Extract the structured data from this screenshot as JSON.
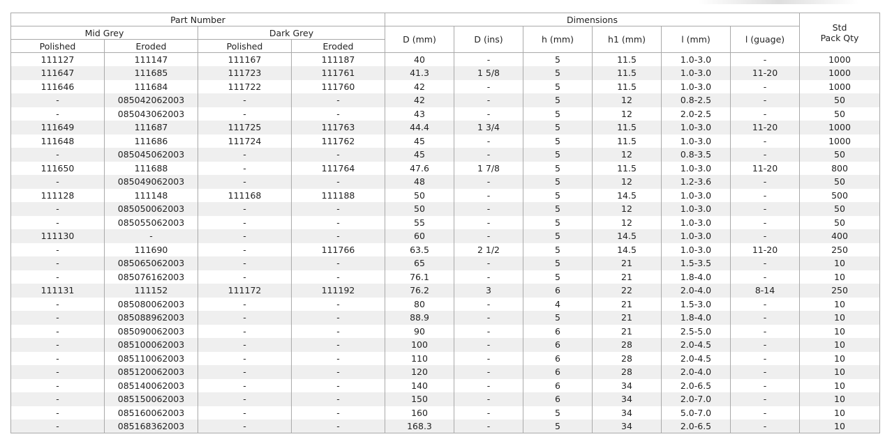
{
  "headers": {
    "part_number": "Part Number",
    "dimensions": "Dimensions",
    "std_line1": "Std",
    "std_line2": "Pack Qty",
    "mid_grey": "Mid Grey",
    "dark_grey": "Dark Grey",
    "polished": "Polished",
    "eroded": "Eroded",
    "d_mm": "D (mm)",
    "d_ins": "D (ins)",
    "h_mm": "h (mm)",
    "h1_mm": "h1 (mm)",
    "l_mm": "l (mm)",
    "l_guage": "l (guage)"
  },
  "rows": [
    [
      "111127",
      "111147",
      "111167",
      "111187",
      "40",
      "-",
      "5",
      "11.5",
      "1.0-3.0",
      "-",
      "1000"
    ],
    [
      "111647",
      "111685",
      "111723",
      "111761",
      "41.3",
      "1 5/8",
      "5",
      "11.5",
      "1.0-3.0",
      "11-20",
      "1000"
    ],
    [
      "111646",
      "111684",
      "111722",
      "111760",
      "42",
      "-",
      "5",
      "11.5",
      "1.0-3.0",
      "-",
      "1000"
    ],
    [
      "-",
      "085042062003",
      "-",
      "-",
      "42",
      "-",
      "5",
      "12",
      "0.8-2.5",
      "-",
      "50"
    ],
    [
      "-",
      "085043062003",
      "-",
      "-",
      "43",
      "-",
      "5",
      "12",
      "2.0-2.5",
      "-",
      "50"
    ],
    [
      "111649",
      "111687",
      "111725",
      "111763",
      "44.4",
      "1 3/4",
      "5",
      "11.5",
      "1.0-3.0",
      "11-20",
      "1000"
    ],
    [
      "111648",
      "111686",
      "111724",
      "111762",
      "45",
      "-",
      "5",
      "11.5",
      "1.0-3.0",
      "-",
      "1000"
    ],
    [
      "-",
      "085045062003",
      "-",
      "-",
      "45",
      "-",
      "5",
      "12",
      "0.8-3.5",
      "-",
      "50"
    ],
    [
      "111650",
      "111688",
      "-",
      "111764",
      "47.6",
      "1 7/8",
      "5",
      "11.5",
      "1.0-3.0",
      "11-20",
      "800"
    ],
    [
      "-",
      "085049062003",
      "-",
      "-",
      "48",
      "-",
      "5",
      "12",
      "1.2-3.6",
      "-",
      "50"
    ],
    [
      "111128",
      "111148",
      "111168",
      "111188",
      "50",
      "-",
      "5",
      "14.5",
      "1.0-3.0",
      "-",
      "500"
    ],
    [
      "-",
      "085050062003",
      "-",
      "-",
      "50",
      "-",
      "5",
      "12",
      "1.0-3.0",
      "-",
      "50"
    ],
    [
      "-",
      "085055062003",
      "-",
      "-",
      "55",
      "-",
      "5",
      "12",
      "1.0-3.0",
      "-",
      "50"
    ],
    [
      "111130",
      "-",
      "-",
      "-",
      "60",
      "-",
      "5",
      "14.5",
      "1.0-3.0",
      "-",
      "400"
    ],
    [
      "-",
      "111690",
      "-",
      "111766",
      "63.5",
      "2 1/2",
      "5",
      "14.5",
      "1.0-3.0",
      "11-20",
      "250"
    ],
    [
      "-",
      "085065062003",
      "-",
      "-",
      "65",
      "-",
      "5",
      "21",
      "1.5-3.5",
      "-",
      "10"
    ],
    [
      "-",
      "085076162003",
      "-",
      "-",
      "76.1",
      "-",
      "5",
      "21",
      "1.8-4.0",
      "-",
      "10"
    ],
    [
      "111131",
      "111152",
      "111172",
      "111192",
      "76.2",
      "3",
      "6",
      "22",
      "2.0-4.0",
      "8-14",
      "250"
    ],
    [
      "-",
      "085080062003",
      "-",
      "-",
      "80",
      "-",
      "4",
      "21",
      "1.5-3.0",
      "-",
      "10"
    ],
    [
      "-",
      "085088962003",
      "-",
      "-",
      "88.9",
      "-",
      "5",
      "21",
      "1.8-4.0",
      "-",
      "10"
    ],
    [
      "-",
      "085090062003",
      "-",
      "-",
      "90",
      "-",
      "6",
      "21",
      "2.5-5.0",
      "-",
      "10"
    ],
    [
      "-",
      "085100062003",
      "-",
      "-",
      "100",
      "-",
      "6",
      "28",
      "2.0-4.5",
      "-",
      "10"
    ],
    [
      "-",
      "085110062003",
      "-",
      "-",
      "110",
      "-",
      "6",
      "28",
      "2.0-4.5",
      "-",
      "10"
    ],
    [
      "-",
      "085120062003",
      "-",
      "-",
      "120",
      "-",
      "6",
      "28",
      "2.0-4.0",
      "-",
      "10"
    ],
    [
      "-",
      "085140062003",
      "-",
      "-",
      "140",
      "-",
      "6",
      "34",
      "2.0-6.5",
      "-",
      "10"
    ],
    [
      "-",
      "085150062003",
      "-",
      "-",
      "150",
      "-",
      "6",
      "34",
      "2.0-7.0",
      "-",
      "10"
    ],
    [
      "-",
      "085160062003",
      "-",
      "-",
      "160",
      "-",
      "5",
      "34",
      "5.0-7.0",
      "-",
      "10"
    ],
    [
      "-",
      "085168362003",
      "-",
      "-",
      "168.3",
      "-",
      "5",
      "34",
      "2.0-6.5",
      "-",
      "10"
    ]
  ]
}
